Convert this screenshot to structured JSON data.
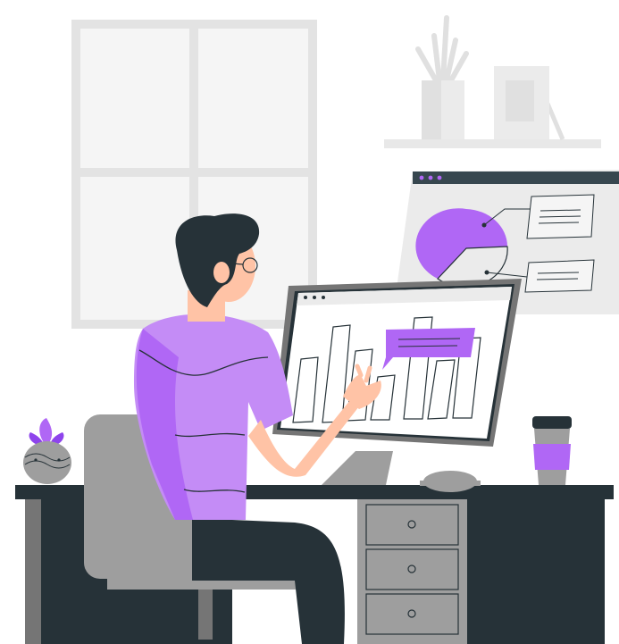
{
  "scene": {
    "subject": "person-at-computer-desk",
    "colors": {
      "background": "#ffffff",
      "wall_light": "#f5f5f5",
      "window_frame": "#e3e3e3",
      "accent": "#b067f5",
      "accent_light": "#c48cf6",
      "dark": "#263238",
      "chair_gray": "#9e9e9e",
      "skin": "#ffc3a6",
      "white": "#ffffff"
    },
    "icons": [
      "window",
      "plant-vase",
      "picture-frame",
      "wall-chart-panel",
      "monitor",
      "bar-chart",
      "coffee-cup",
      "mouse",
      "potted-plant",
      "desk-drawers",
      "office-chair"
    ]
  }
}
